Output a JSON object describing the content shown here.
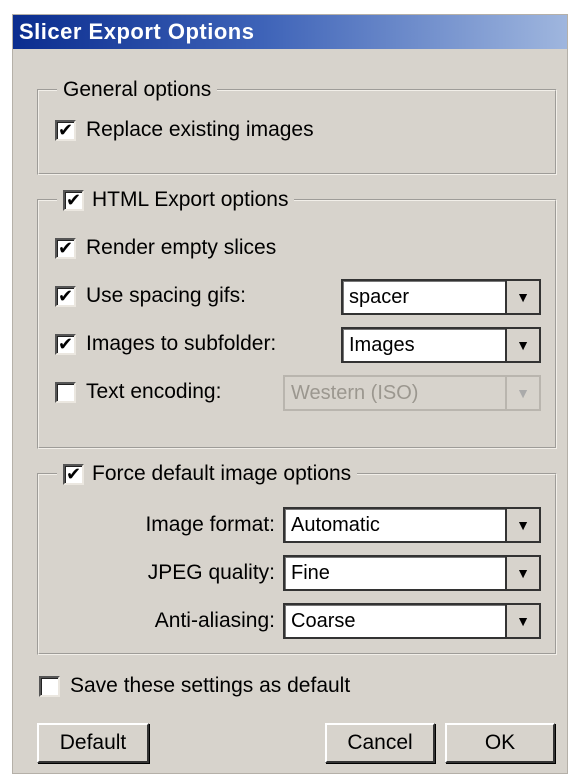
{
  "window": {
    "title": "Slicer Export Options"
  },
  "general": {
    "legend": "General options",
    "replace_images": {
      "label": "Replace existing images",
      "checked": true
    }
  },
  "html_export": {
    "legend": "HTML Export options",
    "checked": true,
    "render_empty": {
      "label": "Render empty slices",
      "checked": true
    },
    "spacing_gifs": {
      "label": "Use spacing gifs:",
      "checked": true,
      "value": "spacer"
    },
    "subfolder": {
      "label": "Images to subfolder:",
      "checked": true,
      "value": "Images"
    },
    "text_encoding": {
      "label": "Text encoding:",
      "checked": false,
      "value": "Western (ISO)"
    }
  },
  "force_default": {
    "legend": "Force default image options",
    "checked": true,
    "image_format": {
      "label": "Image format:",
      "value": "Automatic"
    },
    "jpeg_quality": {
      "label": "JPEG quality:",
      "value": "Fine"
    },
    "anti_aliasing": {
      "label": "Anti-aliasing:",
      "value": "Coarse"
    }
  },
  "save_default": {
    "label": "Save these settings as default",
    "checked": false
  },
  "buttons": {
    "default": "Default",
    "cancel": "Cancel",
    "ok": "OK"
  },
  "glyphs": {
    "check": "✔",
    "arrow": "▼"
  }
}
